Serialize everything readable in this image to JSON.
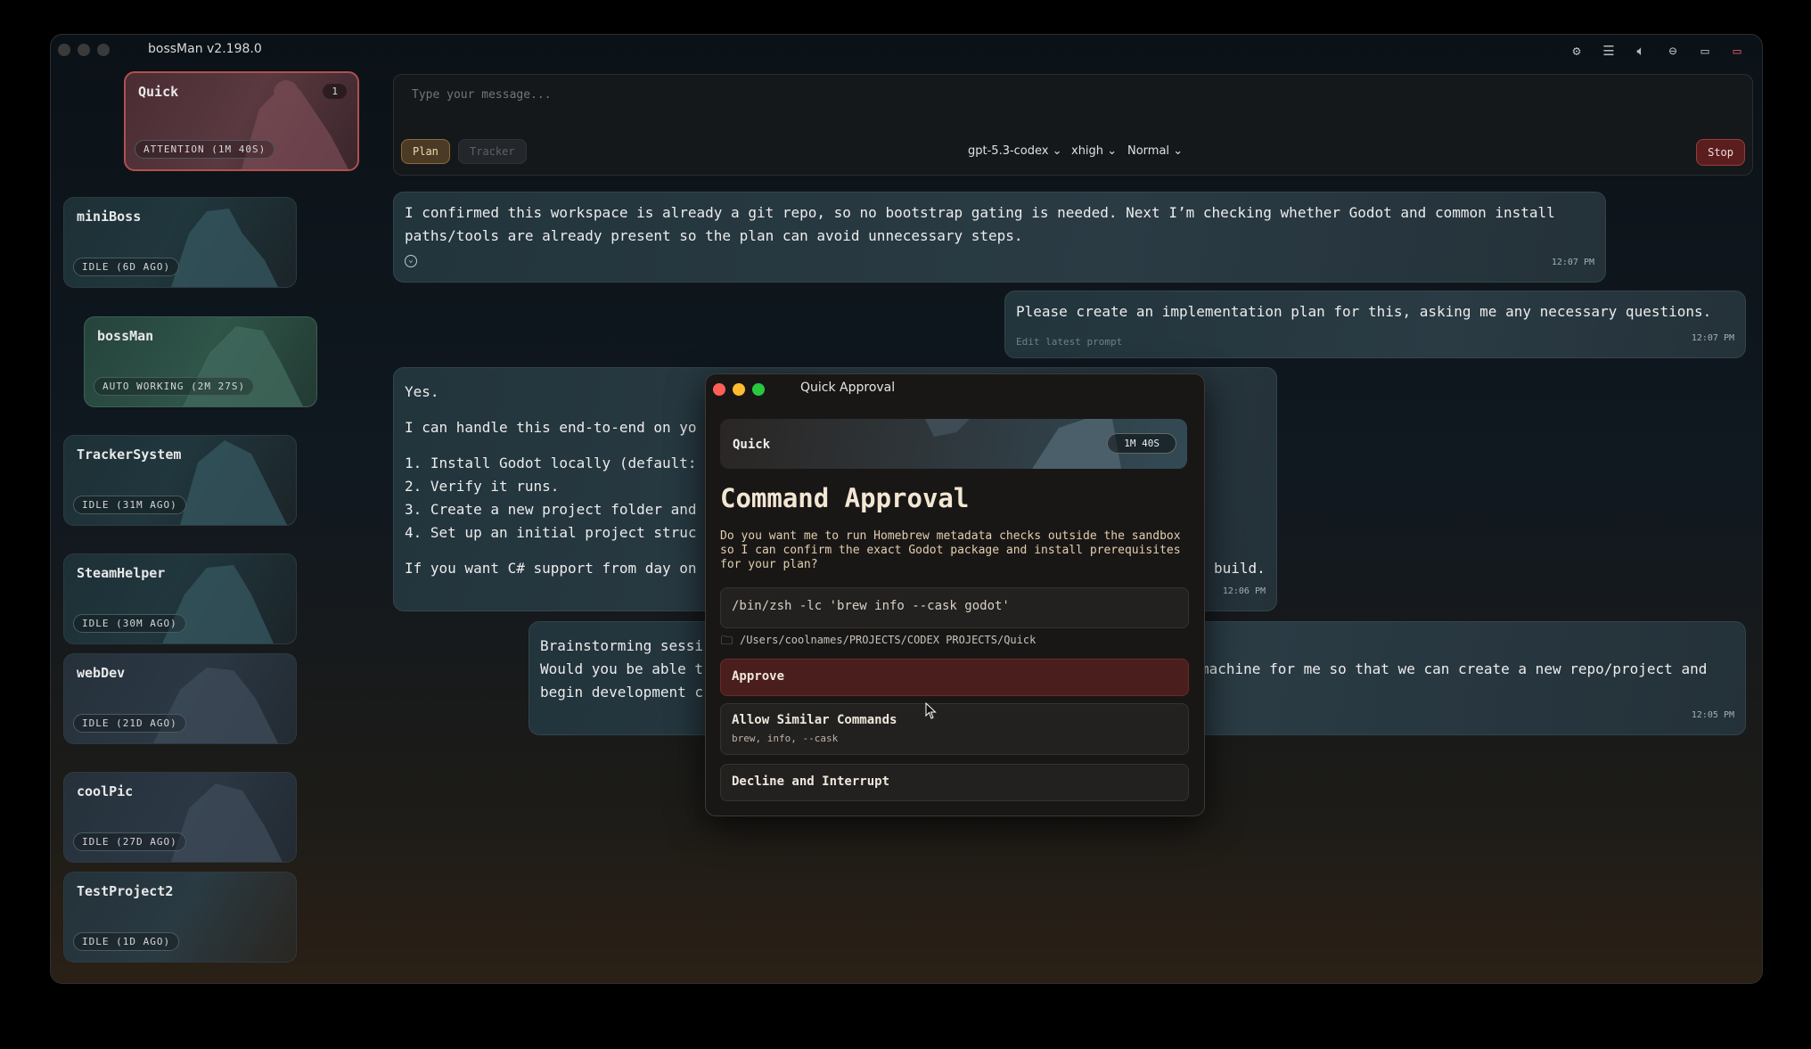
{
  "app": {
    "title": "bossMan v2.198.0"
  },
  "titlebar_icons": [
    "gear-icon",
    "menu-icon",
    "speaker-icon",
    "minus-circle-icon",
    "chat-icon",
    "chat-alert-icon"
  ],
  "sessions": [
    {
      "name": "Quick",
      "status": "ATTENTION (1M 40S)",
      "badge": "1"
    },
    {
      "name": "miniBoss",
      "status": "IDLE (6D AGO)"
    },
    {
      "name": "bossMan",
      "status": "AUTO WORKING (2M 27S)"
    },
    {
      "name": "TrackerSystem",
      "status": "IDLE (31M AGO)"
    },
    {
      "name": "SteamHelper",
      "status": "IDLE (30M AGO)"
    },
    {
      "name": "webDev",
      "status": "IDLE (21D AGO)"
    },
    {
      "name": "coolPic",
      "status": "IDLE (27D AGO)"
    },
    {
      "name": "TestProject2",
      "status": "IDLE (1D AGO)"
    }
  ],
  "composer": {
    "placeholder": "Type your message...",
    "plan_label": "Plan",
    "tracker_label": "Tracker",
    "model": "gpt-5.3-codex",
    "effort": "xhigh",
    "mode": "Normal",
    "stop_label": "Stop"
  },
  "messages": {
    "m1_line1": "I confirmed this workspace is already a git repo, so no bootstrap gating is needed. Next I’m checking whether Godot and common install",
    "m1_line2": "paths/tools are already present so the plan can avoid unnecessary steps.",
    "m1_time": "12:07 PM",
    "m2_text": "Please create an implementation plan for this, asking me any necessary questions.",
    "m2_edit": "Edit latest prompt",
    "m2_time": "12:07 PM",
    "m3_yes": "Yes.",
    "m3_intro": "I can handle this end-to-end on yo",
    "m3_items": [
      "1. Install Godot locally (default:",
      "2. Verify it runs.",
      "3. Create a new project folder and",
      "4. Set up an initial project struc"
    ],
    "m3_csharp": "If you want C# support from day on",
    "m3_tail": "build.",
    "m3_time": "12:06 PM",
    "m4_line1a": "Brainstorming sessi",
    "m4_line2a": "Would you be able t",
    "m4_line2b": "machine for me so that we can create a new repo/project and",
    "m4_line3a": "begin development c",
    "m4_time": "12:05 PM"
  },
  "dialog": {
    "window_title": "Quick Approval",
    "session_name": "Quick",
    "timer": "1M 40S",
    "heading": "Command Approval",
    "description": "Do you want me to run Homebrew metadata checks outside the sandbox so I can confirm the exact Godot package and install prerequisites for your plan?",
    "command": "/bin/zsh -lc 'brew info --cask godot'",
    "path": "/Users/coolnames/PROJECTS/CODEX PROJECTS/Quick",
    "approve_label": "Approve",
    "allow_label": "Allow Similar Commands",
    "allow_sub": "brew, info, --cask",
    "decline_label": "Decline and Interrupt"
  }
}
